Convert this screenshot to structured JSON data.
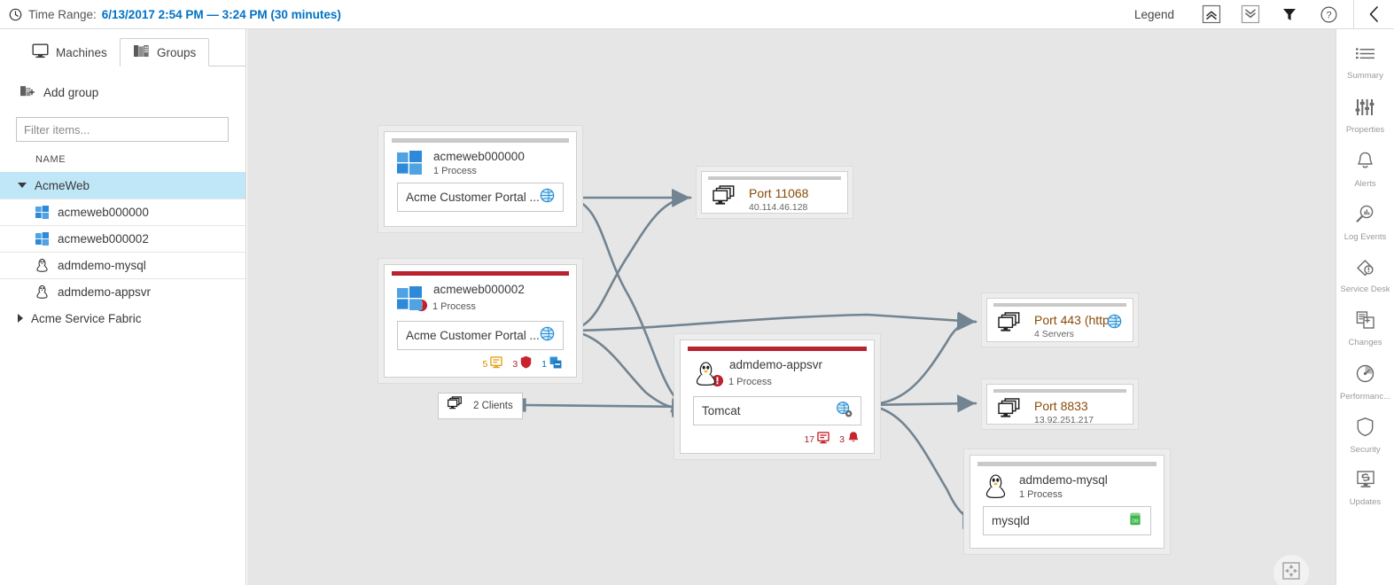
{
  "topbar": {
    "clock_icon": "clock-icon",
    "time_range_label": "Time Range:",
    "time_range_value": "6/13/2017 2:54 PM — 3:24 PM (30 minutes)",
    "legend_label": "Legend",
    "expand_all_icon": "collapse-up-icon",
    "collapse_all_icon": "expand-down-icon",
    "filter_icon": "filter-icon",
    "help_icon": "help-icon",
    "collapse_panel_icon": "chevron-left-icon",
    "accent_color": "#0072c6"
  },
  "sidebar": {
    "tabs": [
      {
        "label": "Machines",
        "icon": "monitor-icon",
        "active": false
      },
      {
        "label": "Groups",
        "icon": "groups-icon",
        "active": true
      }
    ],
    "add_group_label": "Add group",
    "add_group_icon": "add-group-icon",
    "filter_placeholder": "Filter items...",
    "filter_value": "",
    "column_header": "NAME",
    "tree": [
      {
        "label": "AcmeWeb",
        "expanded": true,
        "selected": true,
        "children": [
          {
            "label": "acmeweb000000",
            "icon": "windows-icon"
          },
          {
            "label": "acmeweb000002",
            "icon": "windows-icon"
          },
          {
            "label": "admdemo-mysql",
            "icon": "linux-icon"
          },
          {
            "label": "admdemo-appsvr",
            "icon": "linux-icon"
          }
        ]
      },
      {
        "label": "Acme Service Fabric",
        "expanded": false,
        "selected": false,
        "children": []
      }
    ],
    "selection_color": "#bfe7f7"
  },
  "right_rail": {
    "items": [
      {
        "label": "Summary",
        "icon": "summary-icon"
      },
      {
        "label": "Properties",
        "icon": "properties-icon"
      },
      {
        "label": "Alerts",
        "icon": "bell-icon"
      },
      {
        "label": "Log Events",
        "icon": "log-events-icon"
      },
      {
        "label": "Service Desk",
        "icon": "service-desk-icon"
      },
      {
        "label": "Changes",
        "icon": "changes-icon"
      },
      {
        "label": "Performanc...",
        "icon": "performance-icon"
      },
      {
        "label": "Security",
        "icon": "shield-icon"
      },
      {
        "label": "Updates",
        "icon": "updates-icon"
      }
    ]
  },
  "map": {
    "fit_to_screen_icon": "fit-to-screen-icon",
    "machines": [
      {
        "id": "acmeweb000000",
        "name": "acmeweb000000",
        "process_count": "1 Process",
        "os_icon": "windows-icon",
        "status": "ok",
        "has_error_badge": false,
        "process": {
          "name": "Acme Customer Portal ...",
          "icon": "web-globe-icon"
        },
        "badges": []
      },
      {
        "id": "acmeweb000002",
        "name": "acmeweb000002",
        "process_count": "1 Process",
        "os_icon": "windows-icon",
        "status": "error",
        "has_error_badge": true,
        "process": {
          "name": "Acme Customer Portal ...",
          "icon": "web-globe-icon"
        },
        "badges": [
          {
            "count": "5",
            "icon": "log-events-badge-icon",
            "severity": "warn"
          },
          {
            "count": "3",
            "icon": "security-badge-icon",
            "severity": "err"
          },
          {
            "count": "1",
            "icon": "changes-badge-icon",
            "severity": "info"
          }
        ]
      },
      {
        "id": "admdemo-appsvr",
        "name": "admdemo-appsvr",
        "process_count": "1 Process",
        "os_icon": "linux-icon",
        "status": "error",
        "has_error_badge": true,
        "process": {
          "name": "Tomcat",
          "icon": "web-service-icon"
        },
        "badges": [
          {
            "count": "17",
            "icon": "log-events-badge-icon",
            "severity": "err"
          },
          {
            "count": "3",
            "icon": "alert-bell-badge-icon",
            "severity": "err"
          }
        ]
      },
      {
        "id": "admdemo-mysql",
        "name": "admdemo-mysql",
        "process_count": "1 Process",
        "os_icon": "linux-icon",
        "status": "ok",
        "has_error_badge": false,
        "process": {
          "name": "mysqld",
          "icon": "database-icon"
        },
        "badges": []
      }
    ],
    "ports": [
      {
        "id": "port11068",
        "title": "Port 11068",
        "sub": "40.114.46.128",
        "icon": "servers-icon",
        "side_icon": ""
      },
      {
        "id": "port443",
        "title": "Port 443 (https)",
        "sub": "4 Servers",
        "icon": "servers-icon",
        "side_icon": "web-globe-icon"
      },
      {
        "id": "port8833",
        "title": "Port 8833",
        "sub": "13.92.251.217",
        "icon": "servers-icon",
        "side_icon": ""
      }
    ],
    "clients": [
      {
        "id": "clients2",
        "label": "2 Clients",
        "icon": "servers-icon"
      }
    ],
    "connection_color": "#728491",
    "error_color": "#b8232f"
  }
}
